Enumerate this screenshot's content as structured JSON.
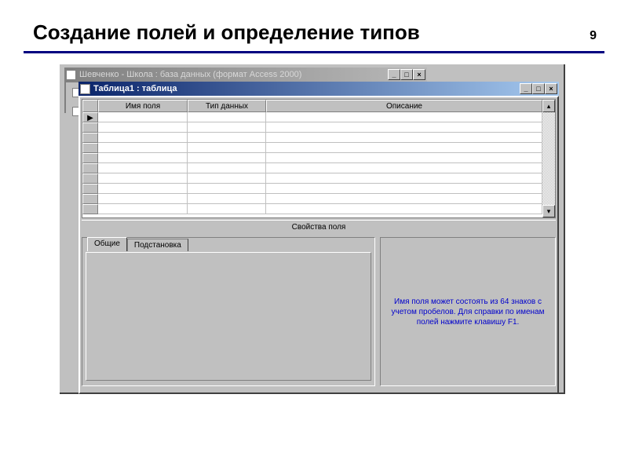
{
  "slide": {
    "title": "Создание полей и определение типов",
    "number": "9"
  },
  "backWindow": {
    "title": "Шевченко - Школа : база данных (формат Access 2000)",
    "controls": {
      "min": "_",
      "max": "□",
      "close": "×"
    }
  },
  "frontWindow": {
    "title": "Таблица1 : таблица",
    "controls": {
      "min": "_",
      "max": "□",
      "close": "×"
    }
  },
  "grid": {
    "headers": {
      "selector": "",
      "name": "Имя поля",
      "type": "Тип данных",
      "desc": "Описание"
    },
    "currentMarker": "▶",
    "rowCount": 10
  },
  "props": {
    "panelLabel": "Свойства поля",
    "tabs": {
      "general": "Общие",
      "lookup": "Подстановка"
    },
    "hint": "Имя поля может состоять из 64 знаков с учетом пробелов. Для справки по именам полей нажмите клавишу F1."
  }
}
